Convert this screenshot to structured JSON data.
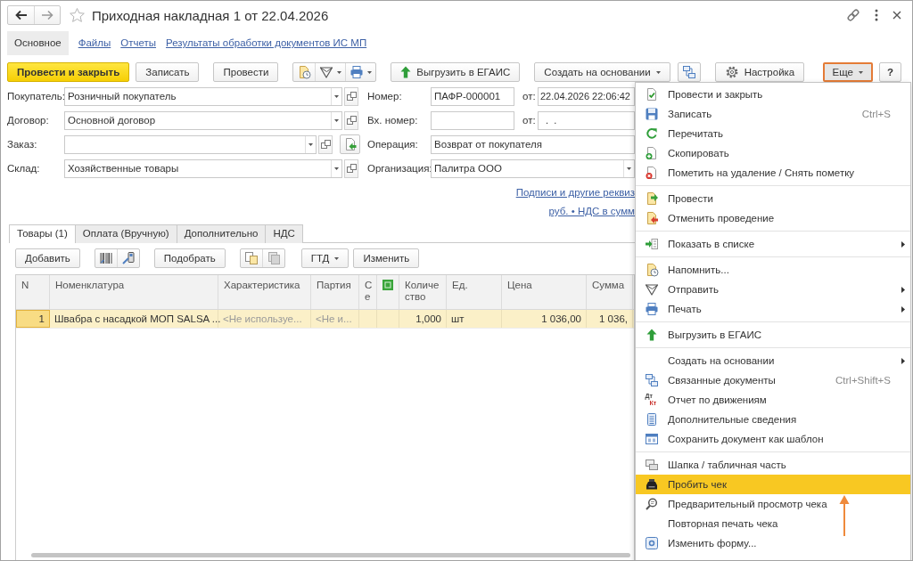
{
  "window": {
    "title": "Приходная накладная 1 от 22.04.2026"
  },
  "sections": [
    {
      "label": "Основное",
      "selected": true
    },
    {
      "label": "Файлы",
      "selected": false
    },
    {
      "label": "Отчеты",
      "selected": false
    },
    {
      "label": "Результаты обработки документов ИС МП",
      "selected": false
    }
  ],
  "toolbar": {
    "post_and_close": {
      "label": "Провести и закрыть",
      "default": true
    },
    "save": {
      "label": "Записать"
    },
    "post": {
      "label": "Провести"
    },
    "unload": {
      "label": "Выгрузить в ЕГАИС"
    },
    "create_based_on": {
      "label": "Создать на основании",
      "dropdown": true
    },
    "settings": {
      "label": "Настройка"
    },
    "more": {
      "label": "Еще",
      "dropdown": true,
      "highlighted": true
    },
    "help": {
      "label": "?"
    }
  },
  "fields_left": [
    {
      "kind": "select",
      "label": "Покупатель:",
      "value": "Розничный покупатель"
    },
    {
      "kind": "select",
      "label": "Договор:",
      "value": "Основной договор"
    },
    {
      "kind": "select_action",
      "label": "Заказ:"
    },
    {
      "kind": "select",
      "label": "Склад:",
      "value": "Хозяйственные товары"
    }
  ],
  "fields_right": [
    {
      "kind": "number_date",
      "label": "Номер:",
      "value": "ПАФР-000001",
      "date_label": "от:",
      "date": "22.04.2026 22:06:42"
    },
    {
      "kind": "number_date",
      "label": "Вх. номер:",
      "date_label": "от:",
      "date": "  .  ."
    },
    {
      "kind": "text",
      "label": "Операция:",
      "value": "Возврат от покупателя"
    },
    {
      "kind": "select",
      "label": "Организация:",
      "value": "Палитра ООО"
    }
  ],
  "links": [
    "Подписи и другие реквиз",
    "руб. • НДС в сумм"
  ],
  "document_tabs": [
    {
      "label": "Товары (1)",
      "selected": true
    },
    {
      "label": "Оплата (Вручную)",
      "selected": false
    },
    {
      "label": "Дополнительно",
      "selected": false
    },
    {
      "label": "НДС",
      "selected": false
    }
  ],
  "table_toolbar": {
    "add": {
      "label": "Добавить"
    },
    "pick": {
      "label": "Подобрать"
    },
    "customs": {
      "label": "ГТД",
      "dropdown": true
    },
    "edit": {
      "label": "Изменить"
    }
  },
  "table": {
    "columns": [
      {
        "kind": "number",
        "label": "N"
      },
      {
        "kind": "text",
        "label": "Номенклатура"
      },
      {
        "kind": "text",
        "label": "Характеристика"
      },
      {
        "kind": "text",
        "label": "Партия"
      },
      {
        "kind": "text",
        "label": "Се"
      },
      {
        "kind": "icon"
      },
      {
        "kind": "number",
        "label": "Количество"
      },
      {
        "kind": "text",
        "label": "Ед."
      },
      {
        "kind": "number",
        "label": "Цена"
      },
      {
        "kind": "number",
        "label": "Сумма"
      }
    ],
    "rows": [
      {
        "selected": true,
        "cells": [
          {
            "text": "1",
            "focused": true,
            "muted": false
          },
          {
            "text": "Швабра с насадкой МОП SALSA ...",
            "focused": false,
            "muted": false
          },
          {
            "text": "<Не используе...",
            "focused": false,
            "muted": true
          },
          {
            "text": "<Не и...",
            "focused": false,
            "muted": true
          },
          null,
          null,
          {
            "text": "1,000",
            "focused": false,
            "muted": false
          },
          {
            "text": "шт",
            "focused": false,
            "muted": false
          },
          {
            "text": "1 036,00",
            "focused": false,
            "muted": false
          },
          {
            "text": "1 036,",
            "focused": false,
            "muted": false
          }
        ]
      }
    ]
  },
  "menu": {
    "groups": [
      {
        "items": [
          {
            "label": "Провести и закрыть",
            "selected": false,
            "submenu": false
          },
          {
            "label": "Записать",
            "shortcut": "Ctrl+S",
            "selected": false,
            "submenu": false
          },
          {
            "label": "Перечитать",
            "selected": false,
            "submenu": false
          },
          {
            "label": "Скопировать",
            "selected": false,
            "submenu": false
          },
          {
            "label": "Пометить на удаление / Снять пометку",
            "selected": false,
            "submenu": false
          }
        ]
      },
      {
        "items": [
          {
            "label": "Провести",
            "selected": false,
            "submenu": false
          },
          {
            "label": "Отменить проведение",
            "selected": false,
            "submenu": false
          }
        ]
      },
      {
        "items": [
          {
            "label": "Показать в списке",
            "selected": false,
            "submenu": true
          }
        ]
      },
      {
        "items": [
          {
            "label": "Напомнить...",
            "selected": false,
            "submenu": false
          },
          {
            "label": "Отправить",
            "selected": false,
            "submenu": true
          },
          {
            "label": "Печать",
            "selected": false,
            "submenu": true
          }
        ]
      },
      {
        "items": [
          {
            "label": "Выгрузить в ЕГАИС",
            "selected": false,
            "submenu": false
          }
        ]
      },
      {
        "items": [
          {
            "label": "Создать на основании",
            "selected": false,
            "submenu": true
          },
          {
            "label": "Связанные документы",
            "shortcut": "Ctrl+Shift+S",
            "selected": false,
            "submenu": false
          },
          {
            "label": "Отчет по движениям",
            "icon_letters": [
              "Дт",
              "Кт"
            ],
            "selected": false,
            "submenu": false
          },
          {
            "label": "Дополнительные сведения",
            "selected": false,
            "submenu": false
          },
          {
            "label": "Сохранить документ как шаблон",
            "selected": false,
            "submenu": false
          }
        ]
      },
      {
        "items": [
          {
            "label": "Шапка / табличная часть",
            "selected": false,
            "submenu": false
          },
          {
            "label": "Пробить чек",
            "selected": true,
            "submenu": false
          },
          {
            "label": "Предварительный просмотр чека",
            "selected": false,
            "submenu": false
          },
          {
            "label": "Повторная печать чека",
            "selected": false,
            "submenu": false
          },
          {
            "label": "Изменить форму...",
            "selected": false,
            "submenu": false
          }
        ]
      }
    ]
  },
  "annotations": [
    {
      "kind": "arrow"
    }
  ]
}
